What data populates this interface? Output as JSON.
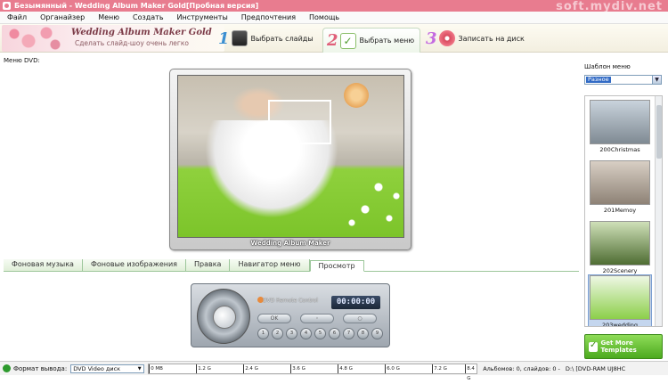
{
  "window": {
    "title": "Безымянный - Wedding Album Maker Gold[Пробная версия]",
    "watermark": "soft.mydiv.net"
  },
  "menu": [
    "Файл",
    "Органайзер",
    "Меню",
    "Создать",
    "Инструменты",
    "Предпочтения",
    "Помощь"
  ],
  "header": {
    "logo_name": "Wedding Album Maker Gold",
    "logo_slogan": "Сделать слайд-шоу очень легко",
    "steps": [
      {
        "num": "1",
        "label": "Выбрать слайды"
      },
      {
        "num": "2",
        "label": "Выбрать меню"
      },
      {
        "num": "3",
        "label": "Записать на диск"
      }
    ]
  },
  "main": {
    "dvd_label": "Меню DVD:",
    "preview_caption": "Wedding Album Maker"
  },
  "tabs": [
    "Фоновая музыка",
    "Фоновые изображения",
    "Правка",
    "Навигатор меню",
    "Просмотр"
  ],
  "active_tab": 4,
  "player": {
    "remote_title": "DVD Remote Control",
    "time": "00:00:00",
    "top_buttons": [
      "OK",
      "◦",
      "○"
    ],
    "numbers": [
      "1",
      "2",
      "3",
      "4",
      "5",
      "6",
      "7",
      "8",
      "9"
    ]
  },
  "right_panel": {
    "label": "Шаблон меню",
    "select_value": "Разное",
    "templates": [
      {
        "name": "200Christmas",
        "colors": [
          "#c9d3dc",
          "#7f8a93"
        ]
      },
      {
        "name": "201Memoy",
        "colors": [
          "#d8cfc4",
          "#8e8276"
        ]
      },
      {
        "name": "202Scenery",
        "colors": [
          "#cfe0b8",
          "#4f6d33"
        ]
      },
      {
        "name": "203wedding",
        "colors": [
          "#eef7e4",
          "#8ccf4a"
        ]
      }
    ],
    "selected_template": 3,
    "more_button": "Get More Templates"
  },
  "status": {
    "format_label": "Формат вывода:",
    "format_value": "DVD Video диск",
    "capacity_ticks": [
      "0 MB",
      "1.2 G",
      "2.4 G",
      "3.6 G",
      "4.8 G",
      "6.0 G",
      "7.2 G",
      "8.4 G"
    ],
    "albums": "Альбомов: 0, слайдов: 0 -",
    "drive": "D:\\ [DVD-RAM UJ8HC"
  }
}
